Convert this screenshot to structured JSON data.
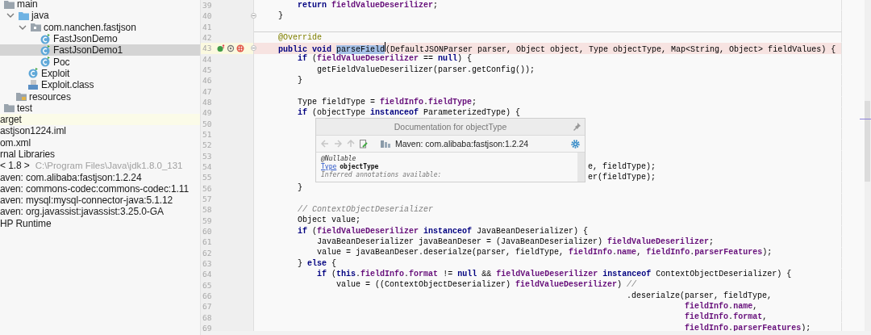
{
  "project_tree": {
    "items": [
      {
        "label": "main",
        "kind": "folder",
        "selected": false,
        "children": [
          {
            "label": "java",
            "kind": "source-folder",
            "expanded": true,
            "selected": false,
            "children": [
              {
                "label": "com.nanchen.fastjson",
                "kind": "package",
                "expanded": true,
                "selected": false,
                "children": [
                  {
                    "label": "FastJsonDemo",
                    "kind": "class",
                    "selected": false
                  },
                  {
                    "label": "FastJsonDemo1",
                    "kind": "class",
                    "selected": true
                  },
                  {
                    "label": "Poc",
                    "kind": "class",
                    "selected": false
                  }
                ]
              },
              {
                "label": "Exploit",
                "kind": "class",
                "selected": false
              },
              {
                "label": "Exploit.class",
                "kind": "classfile",
                "selected": false
              }
            ]
          },
          {
            "label": "resources",
            "kind": "resources",
            "selected": false
          }
        ]
      },
      {
        "label": "test",
        "kind": "folder",
        "selected": false
      },
      {
        "label": "arget",
        "kind": "excluded",
        "selected": false
      },
      {
        "label": "astjson1224.iml",
        "kind": "clipped",
        "selected": false
      },
      {
        "label": "om.xml",
        "kind": "clipped",
        "selected": false
      },
      {
        "label": "rnal Libraries",
        "kind": "clipped",
        "selected": false
      },
      {
        "label": "< 1.8 >",
        "detail": "C:\\Program Files\\Java\\jdk1.8.0_131",
        "kind": "clipped",
        "selected": false
      },
      {
        "label": "aven: com.alibaba:fastjson:1.2.24",
        "kind": "clipped",
        "selected": false
      },
      {
        "label": "aven: commons-codec:commons-codec:1.11",
        "kind": "clipped",
        "selected": false
      },
      {
        "label": "aven: mysql:mysql-connector-java:5.1.12",
        "kind": "clipped",
        "selected": false
      },
      {
        "label": "aven: org.javassist:javassist:3.25.0-GA",
        "kind": "clipped",
        "selected": false
      },
      {
        "label": "HP Runtime",
        "kind": "clipped",
        "selected": false
      }
    ]
  },
  "editor": {
    "lines": [
      {
        "number": "39",
        "segments": [
          {
            "text": "        return",
            "kind": "keyword"
          },
          {
            "text": " fieldValueDeserilizer",
            "kind": "field"
          },
          {
            "text": ";",
            "kind": "plain"
          }
        ]
      },
      {
        "number": "40",
        "fold": true,
        "segments": [
          {
            "text": "    }",
            "kind": "plain"
          }
        ]
      },
      {
        "number": "41",
        "separator": true
      },
      {
        "number": "42",
        "segments": [
          {
            "text": "    @Override",
            "kind": "annotation"
          }
        ]
      },
      {
        "number": "43",
        "fold": true,
        "breakpoint": true,
        "override": true,
        "segments": [
          {
            "text": "    public void ",
            "kind": "keyword"
          },
          {
            "text": "parseField",
            "kind": "selection"
          },
          {
            "text": "(DefaultJSONParser parser, Object object, Type objectType, Map<String, Object> fieldValues) {",
            "kind": "plain"
          }
        ]
      },
      {
        "number": "44",
        "segments": [
          {
            "text": "        if",
            "kind": "keyword"
          },
          {
            "text": " (",
            "kind": "plain"
          },
          {
            "text": "fieldValueDeserilizer",
            "kind": "field"
          },
          {
            "text": " == ",
            "kind": "plain"
          },
          {
            "text": "null",
            "kind": "keyword"
          },
          {
            "text": ") {",
            "kind": "plain"
          }
        ]
      },
      {
        "number": "45",
        "segments": [
          {
            "text": "            getFieldValueDeserilizer(parser.getConfig());",
            "kind": "plain"
          }
        ]
      },
      {
        "number": "46",
        "segments": [
          {
            "text": "        }",
            "kind": "plain"
          }
        ]
      },
      {
        "number": "47"
      },
      {
        "number": "48",
        "segments": [
          {
            "text": "        Type fieldType = ",
            "kind": "plain"
          },
          {
            "text": "fieldInfo",
            "kind": "field"
          },
          {
            "text": ".",
            "kind": "plain"
          },
          {
            "text": "fieldType",
            "kind": "field"
          },
          {
            "text": ";",
            "kind": "plain"
          }
        ]
      },
      {
        "number": "49",
        "segments": [
          {
            "text": "        if",
            "kind": "keyword"
          },
          {
            "text": " (objectType ",
            "kind": "plain"
          },
          {
            "text": "instanceof",
            "kind": "keyword"
          },
          {
            "text": " ParameterizedType) {",
            "kind": "plain"
          }
        ]
      },
      {
        "number": "50"
      },
      {
        "number": "51"
      },
      {
        "number": "52"
      },
      {
        "number": "53"
      },
      {
        "number": "54",
        "segments": [
          {
            "text": "                                                                    e, fieldType);",
            "kind": "plain"
          }
        ]
      },
      {
        "number": "55",
        "segments": [
          {
            "text": "                                                                    er(fieldType);",
            "kind": "plain"
          }
        ]
      },
      {
        "number": "56",
        "segments": [
          {
            "text": "        }",
            "kind": "plain"
          }
        ]
      },
      {
        "number": "57"
      },
      {
        "number": "58",
        "segments": [
          {
            "text": "        // ContextObjectDeserializer",
            "kind": "comment"
          }
        ]
      },
      {
        "number": "59",
        "segments": [
          {
            "text": "        Object value;",
            "kind": "plain"
          }
        ]
      },
      {
        "number": "60",
        "segments": [
          {
            "text": "        if",
            "kind": "keyword"
          },
          {
            "text": " (",
            "kind": "plain"
          },
          {
            "text": "fieldValueDeserilizer",
            "kind": "field"
          },
          {
            "text": " instanceof",
            "kind": "keyword"
          },
          {
            "text": " JavaBeanDeserializer) {",
            "kind": "plain"
          }
        ]
      },
      {
        "number": "61",
        "segments": [
          {
            "text": "            JavaBeanDeserializer javaBeanDeser = (JavaBeanDeserializer) ",
            "kind": "plain"
          },
          {
            "text": "fieldValueDeserilizer",
            "kind": "field"
          },
          {
            "text": ";",
            "kind": "plain"
          }
        ]
      },
      {
        "number": "62",
        "segments": [
          {
            "text": "            value = javaBeanDeser.deserialze(parser, fieldType, ",
            "kind": "plain"
          },
          {
            "text": "fieldInfo",
            "kind": "field"
          },
          {
            "text": ".",
            "kind": "plain"
          },
          {
            "text": "name",
            "kind": "field"
          },
          {
            "text": ", ",
            "kind": "plain"
          },
          {
            "text": "fieldInfo",
            "kind": "field"
          },
          {
            "text": ".",
            "kind": "plain"
          },
          {
            "text": "parserFeatures",
            "kind": "field"
          },
          {
            "text": ");",
            "kind": "plain"
          }
        ]
      },
      {
        "number": "63",
        "segments": [
          {
            "text": "        } ",
            "kind": "plain"
          },
          {
            "text": "else",
            "kind": "keyword"
          },
          {
            "text": " {",
            "kind": "plain"
          }
        ]
      },
      {
        "number": "64",
        "segments": [
          {
            "text": "            if",
            "kind": "keyword"
          },
          {
            "text": " (",
            "kind": "plain"
          },
          {
            "text": "this",
            "kind": "keyword"
          },
          {
            "text": ".",
            "kind": "plain"
          },
          {
            "text": "fieldInfo",
            "kind": "field"
          },
          {
            "text": ".",
            "kind": "plain"
          },
          {
            "text": "format",
            "kind": "field"
          },
          {
            "text": " != ",
            "kind": "plain"
          },
          {
            "text": "null",
            "kind": "keyword"
          },
          {
            "text": " && ",
            "kind": "plain"
          },
          {
            "text": "fieldValueDeserilizer",
            "kind": "field"
          },
          {
            "text": " instanceof",
            "kind": "keyword"
          },
          {
            "text": " ContextObjectDeserializer) {",
            "kind": "plain"
          }
        ]
      },
      {
        "number": "65",
        "segments": [
          {
            "text": "                value = ((ContextObjectDeserializer) ",
            "kind": "plain"
          },
          {
            "text": "fieldValueDeserilizer",
            "kind": "field"
          },
          {
            "text": ") ",
            "kind": "plain"
          },
          {
            "text": "//",
            "kind": "comment"
          }
        ]
      },
      {
        "number": "66",
        "segments": [
          {
            "text": "                                                                            .deserialze(parser, fieldType,",
            "kind": "plain"
          }
        ]
      },
      {
        "number": "67",
        "segments": [
          {
            "text": "                                                                                        fieldInfo",
            "kind": "field"
          },
          {
            "text": ".",
            "kind": "plain"
          },
          {
            "text": "name",
            "kind": "field"
          },
          {
            "text": ",",
            "kind": "plain"
          }
        ]
      },
      {
        "number": "68",
        "segments": [
          {
            "text": "                                                                                        fieldInfo",
            "kind": "field"
          },
          {
            "text": ".",
            "kind": "plain"
          },
          {
            "text": "format",
            "kind": "field"
          },
          {
            "text": ",",
            "kind": "plain"
          }
        ]
      },
      {
        "number": "69",
        "segments": [
          {
            "text": "                                                                                        fieldInfo",
            "kind": "field"
          },
          {
            "text": ".",
            "kind": "plain"
          },
          {
            "text": "parserFeatures",
            "kind": "field"
          },
          {
            "text": ");",
            "kind": "plain"
          }
        ]
      }
    ]
  },
  "doc_popup": {
    "title": "Documentation for objectType",
    "source": "Maven: com.alibaba:fastjson:1.2.24",
    "annotation": "@Nullable",
    "type_link": "Type",
    "symbol": "objectType",
    "note": "Inferred annotations available:"
  }
}
